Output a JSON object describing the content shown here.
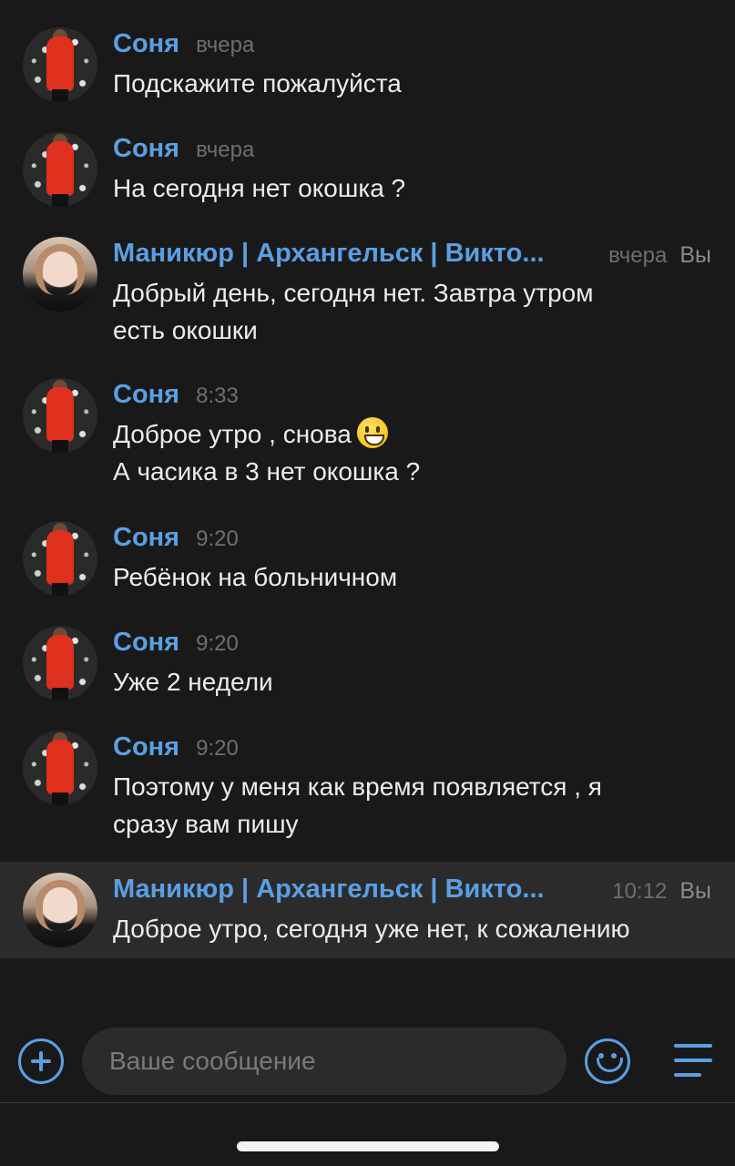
{
  "messages": [
    {
      "author": "Соня",
      "time": "вчера",
      "lines": [
        "Подскажите пожалуйста"
      ]
    },
    {
      "author": "Соня",
      "time": "вчера",
      "lines": [
        "На сегодня нет окошка ?"
      ]
    },
    {
      "author": "Маникюр | Архангельск | Викто...",
      "time": "вчера",
      "you": "Вы",
      "lines": [
        "Добрый день, сегодня нет. Завтра утром",
        "есть окошки"
      ]
    },
    {
      "author": "Соня",
      "time": "8:33",
      "lines": [
        "Доброе утро , снова",
        "А часика в 3 нет окошка ?"
      ],
      "emoji": "grinning-face-emoji"
    },
    {
      "author": "Соня",
      "time": "9:20",
      "lines": [
        "Ребёнок на больничном"
      ]
    },
    {
      "author": "Соня",
      "time": "9:20",
      "lines": [
        "Уже 2 недели"
      ]
    },
    {
      "author": "Соня",
      "time": "9:20",
      "lines": [
        "Поэтому у меня как время появляется , я",
        "сразу вам пишу"
      ]
    },
    {
      "author": "Маникюр | Архангельск | Викто...",
      "time": "10:12",
      "you": "Вы",
      "lines": [
        "Доброе утро, сегодня уже нет, к сожалению"
      ]
    }
  ],
  "composer": {
    "placeholder": "Ваше сообщение",
    "icons": [
      "plus-icon",
      "emoji-smile-icon",
      "menu-icon"
    ]
  },
  "colors": {
    "background": "#191919",
    "accent": "#5b9fe3",
    "highlight_row": "#2b2b2b"
  }
}
